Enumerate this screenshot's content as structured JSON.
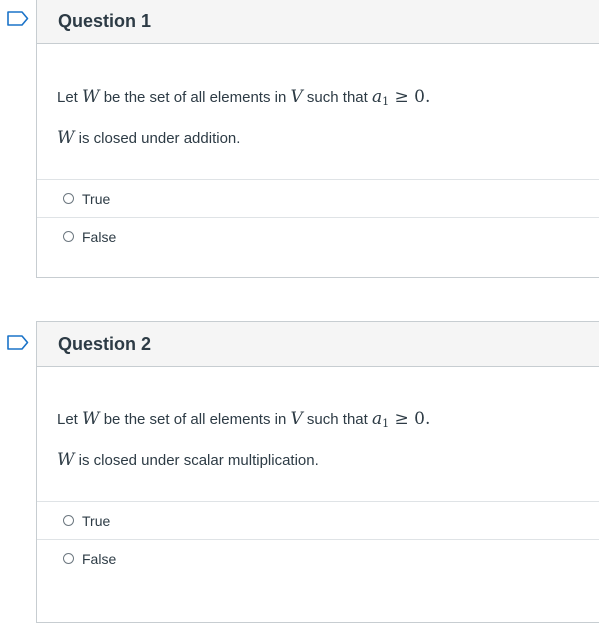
{
  "questions": [
    {
      "title": "Question 1",
      "lead": "Let",
      "var_w": "W",
      "middle": "be the set of all elements in",
      "var_v": "V",
      "such_that": "such that",
      "cond_var": "a",
      "cond_sub": "1",
      "cond_rel": "≥ 0",
      "period": ".",
      "claim_var": "W",
      "claim_text": "is closed under addition.",
      "options": [
        "True",
        "False"
      ]
    },
    {
      "title": "Question 2",
      "lead": "Let",
      "var_w": "W",
      "middle": "be the set of all elements in",
      "var_v": "V",
      "such_that": "such that",
      "cond_var": "a",
      "cond_sub": "1",
      "cond_rel": "≥ 0",
      "period": ".",
      "claim_var": "W",
      "claim_text": "is closed under scalar multiplication.",
      "options": [
        "True",
        "False"
      ]
    }
  ],
  "colors": {
    "flag": "#1a73c8",
    "header_bg": "#f5f5f5",
    "border": "#c7cdd1",
    "text": "#2d3b45"
  },
  "icons": {
    "flag": "flag-question-icon",
    "radio": "radio-unselected-icon"
  }
}
